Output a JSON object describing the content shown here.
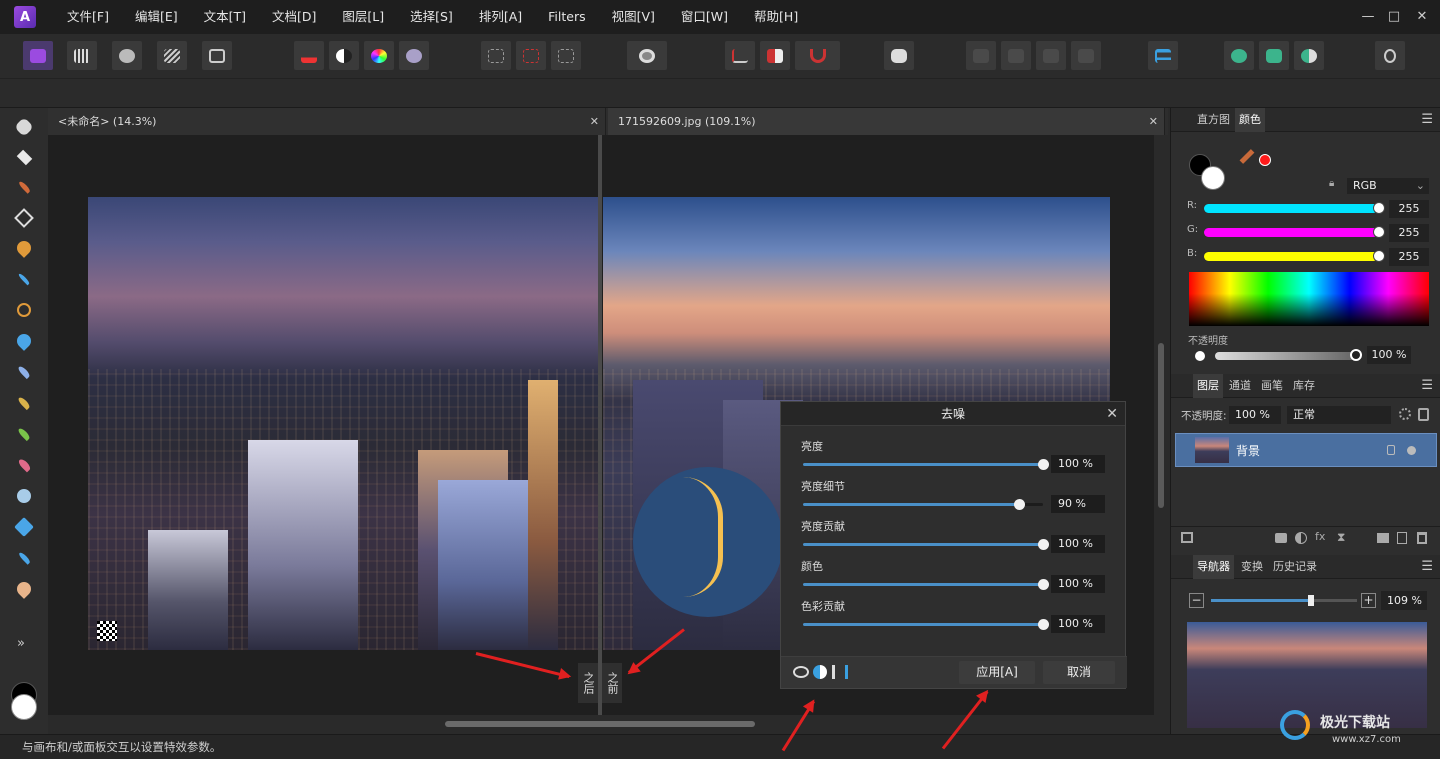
{
  "menubar": {
    "items": [
      "文件[F]",
      "编辑[E]",
      "文本[T]",
      "文档[D]",
      "图层[L]",
      "选择[S]",
      "排列[A]",
      "Filters",
      "视图[V]",
      "窗口[W]",
      "帮助[H]"
    ],
    "window_controls": [
      "—",
      "□",
      "✕"
    ]
  },
  "tools": [
    "hand-tool-icon",
    "move-tool-icon",
    "color-picker-tool-icon",
    "crop-tool-icon",
    "paint-mixer-brush-icon",
    "selection-brush-icon",
    "freehand-selection-icon",
    "flood-fill-icon",
    "paint-brush-icon",
    "clone-brush-icon",
    "retouch-brush-icon",
    "erase-brush-icon",
    "blur-brush-icon",
    "dodge-brush-icon",
    "sponge-brush-icon",
    "smudge-brush-icon"
  ],
  "tools_more": "»",
  "doctabs": [
    {
      "label": "<未命名> (14.3%)",
      "close": "✕"
    },
    {
      "label": "171592609.jpg (109.1%)",
      "close": "✕"
    }
  ],
  "split_labels": {
    "after": "之后",
    "before": "之前"
  },
  "dialog": {
    "title": "去噪",
    "close": "✕",
    "sliders": [
      {
        "label": "亮度",
        "value": "100 %",
        "fraction": 1.0
      },
      {
        "label": "亮度细节",
        "value": "90 %",
        "fraction": 0.9
      },
      {
        "label": "亮度贡献",
        "value": "100 %",
        "fraction": 1.0
      },
      {
        "label": "颜色",
        "value": "100 %",
        "fraction": 1.0
      },
      {
        "label": "色彩贡献",
        "value": "100 %",
        "fraction": 1.0
      }
    ],
    "apply": "应用[A]",
    "cancel": "取消"
  },
  "status": "与画布和/或面板交互以设置特效参数。",
  "panel_color": {
    "tabs": [
      "直方图",
      "颜色"
    ],
    "mode": "RGB",
    "channels": [
      {
        "label": "R:",
        "value": "255",
        "color": "#00e5ff"
      },
      {
        "label": "G:",
        "value": "255",
        "color": "#ff00ff"
      },
      {
        "label": "B:",
        "value": "255",
        "color": "#ffff00"
      }
    ],
    "opacity_label": "不透明度",
    "opacity_value": "100 %"
  },
  "panel_layers": {
    "tabs": [
      "图层",
      "通道",
      "画笔",
      "库存"
    ],
    "opacity_label": "不透明度:",
    "opacity_value": "100 %",
    "blend_mode": "正常",
    "layer_name": "背景"
  },
  "panel_nav": {
    "tabs": [
      "导航器",
      "变换",
      "历史记录"
    ],
    "zoom": "109 %"
  },
  "watermark": {
    "text": "极光下载站",
    "url": "www.xz7.com"
  },
  "colors": {
    "accent": "#4a90c8",
    "layer_selected": "#4a6fa0",
    "annotation_arrow": "#e02020"
  }
}
